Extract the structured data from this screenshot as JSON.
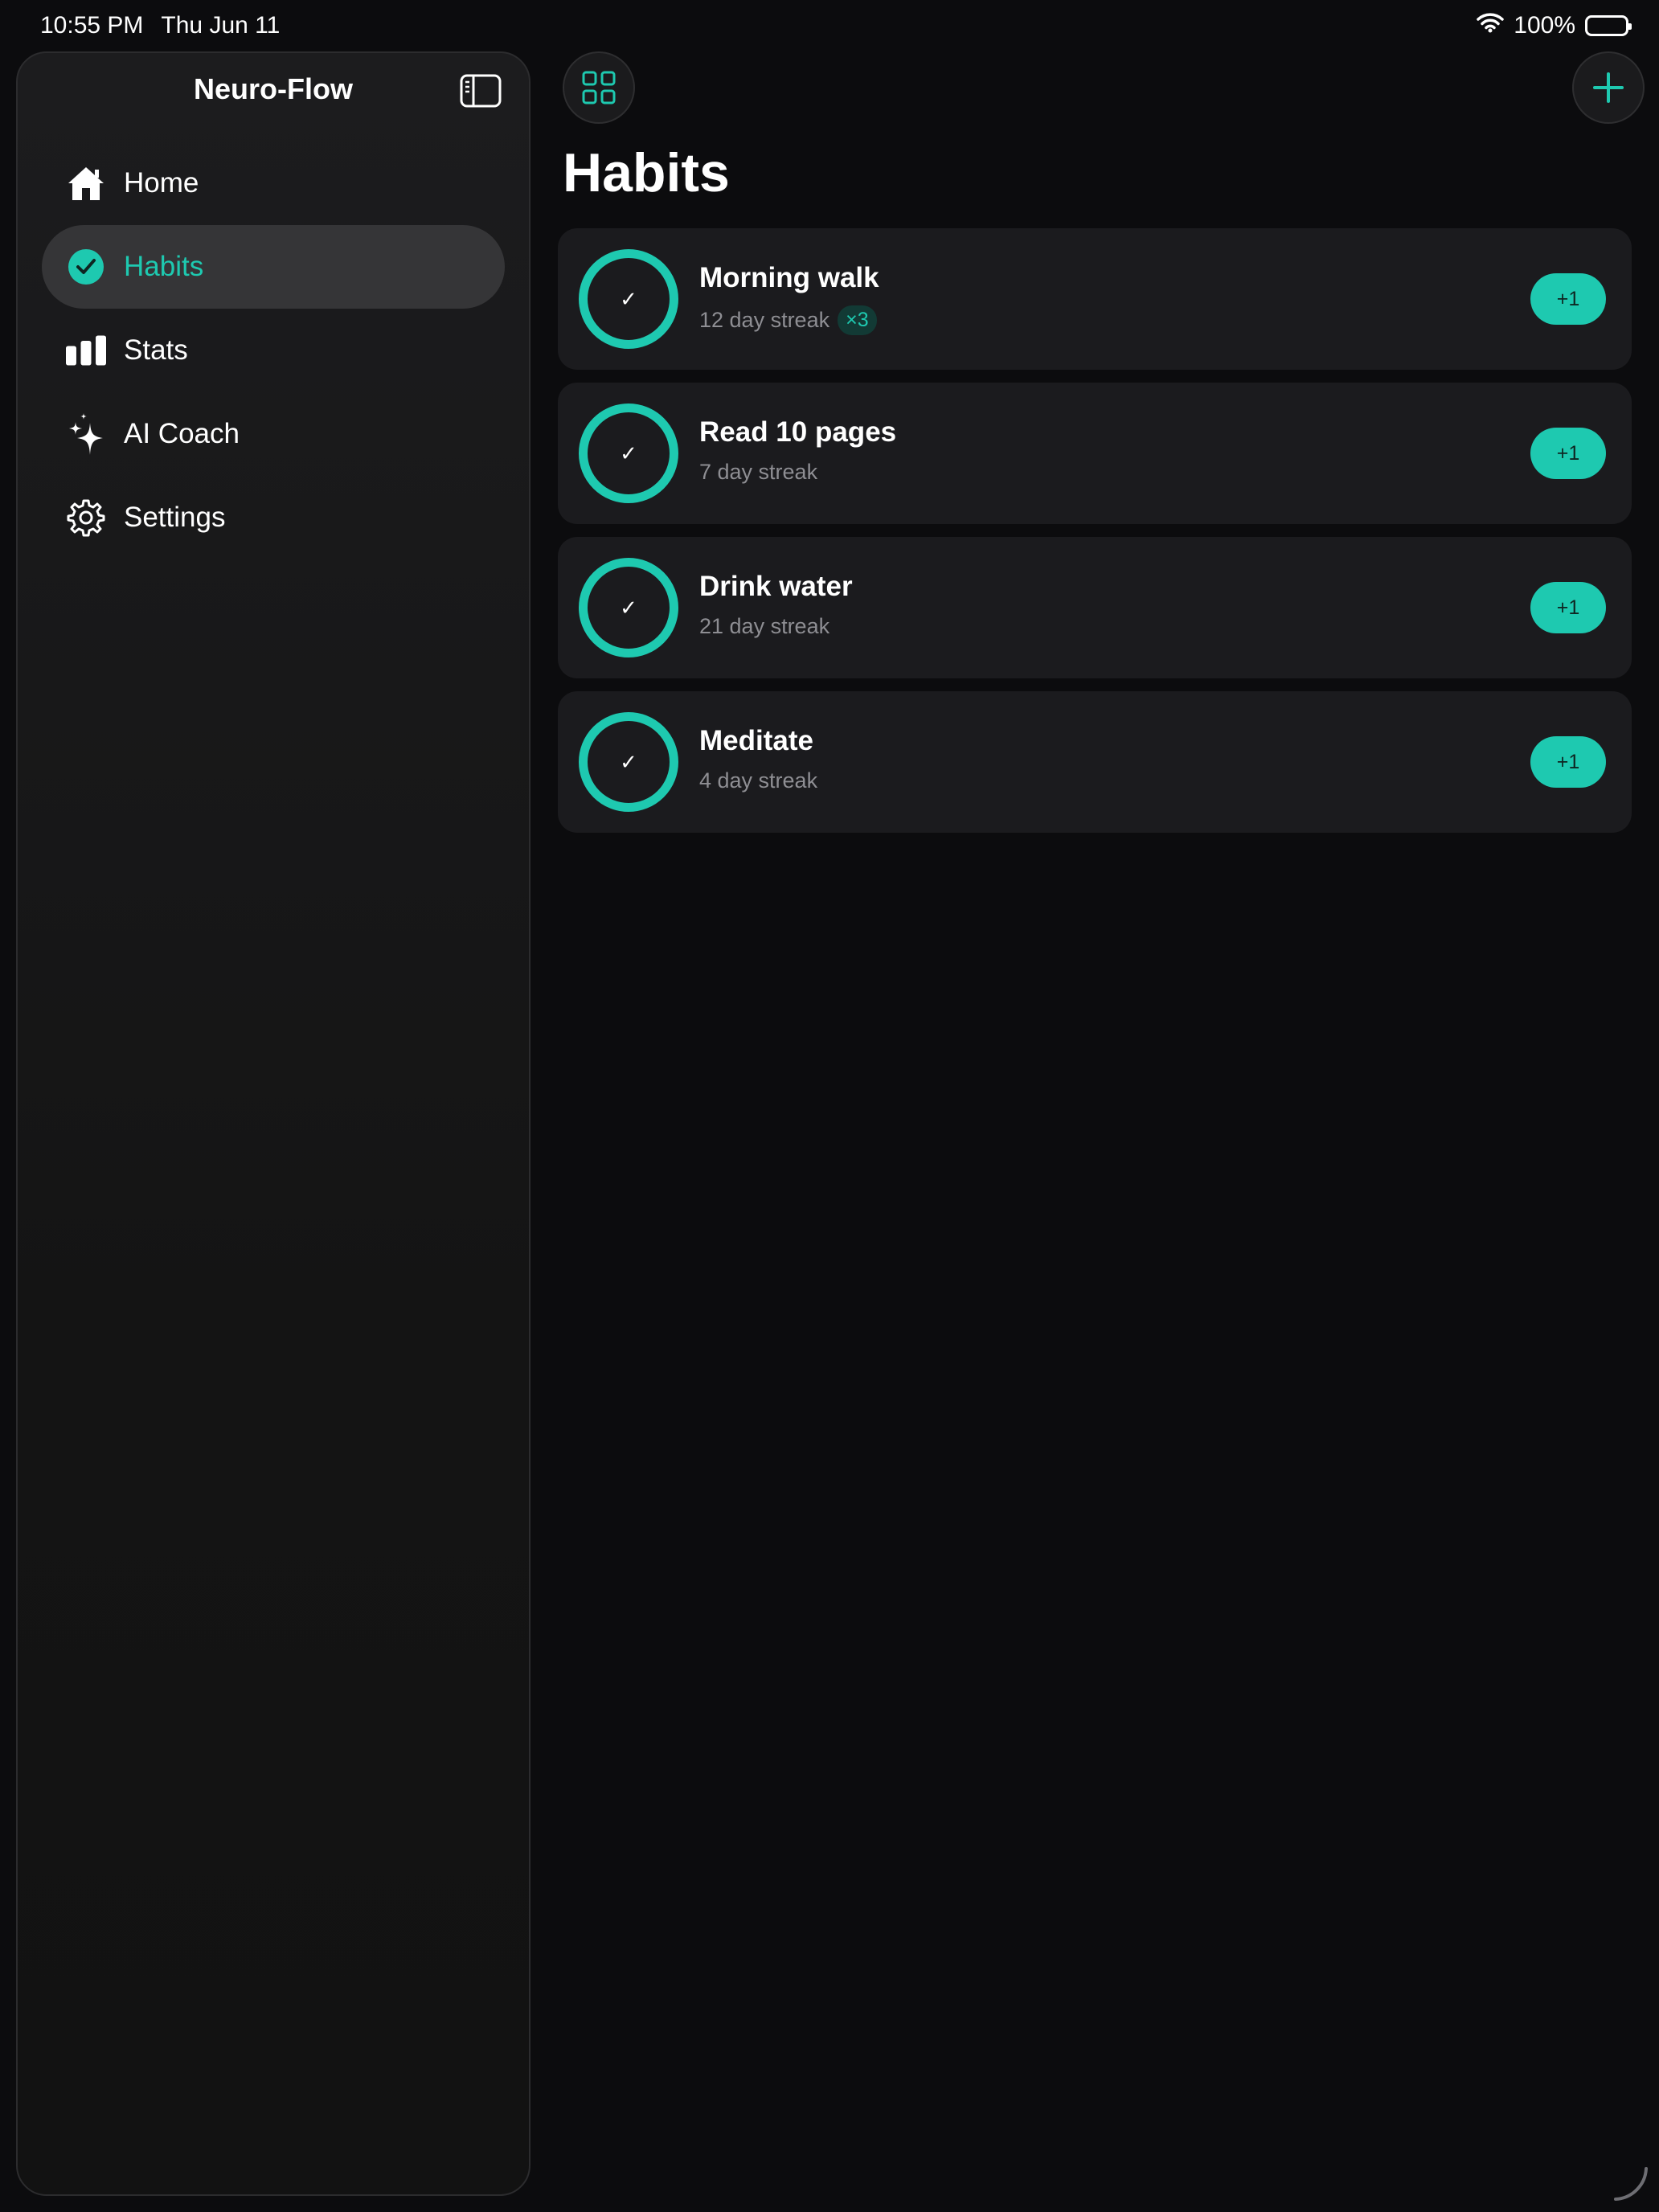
{
  "status_bar": {
    "time": "10:55 PM",
    "date": "Thu Jun 11",
    "battery": "100%",
    "wifi_icon": "wifi-icon",
    "battery_icon": "battery-icon"
  },
  "sidebar": {
    "title": "Neuro-Flow",
    "toggle_icon": "sidebar-toggle-icon",
    "items": [
      {
        "label": "Home",
        "icon": "house-icon",
        "active": false
      },
      {
        "label": "Habits",
        "icon": "checkmark-circle-icon",
        "active": true
      },
      {
        "label": "Stats",
        "icon": "bar-chart-icon",
        "active": false
      },
      {
        "label": "AI Coach",
        "icon": "sparkles-icon",
        "active": false
      },
      {
        "label": "Settings",
        "icon": "gear-icon",
        "active": false
      }
    ]
  },
  "toolbar": {
    "grid_icon": "grid-icon",
    "add_icon": "plus-icon"
  },
  "main": {
    "title": "Habits",
    "habits": [
      {
        "name": "Morning walk",
        "streak": "12 day streak",
        "badge": "×3",
        "button": "+1"
      },
      {
        "name": "Read 10 pages",
        "streak": "7 day streak",
        "badge": "",
        "button": "+1"
      },
      {
        "name": "Drink water",
        "streak": "21 day streak",
        "badge": "",
        "button": "+1"
      },
      {
        "name": "Meditate",
        "streak": "4 day streak",
        "badge": "",
        "button": "+1"
      }
    ],
    "check_glyph": "✓"
  },
  "colors": {
    "accent": "#1ec9b0",
    "background": "#0c0c0e",
    "card": "#1b1b1e",
    "sidebar_active": "#353537",
    "secondary_text": "#8e8e93"
  }
}
